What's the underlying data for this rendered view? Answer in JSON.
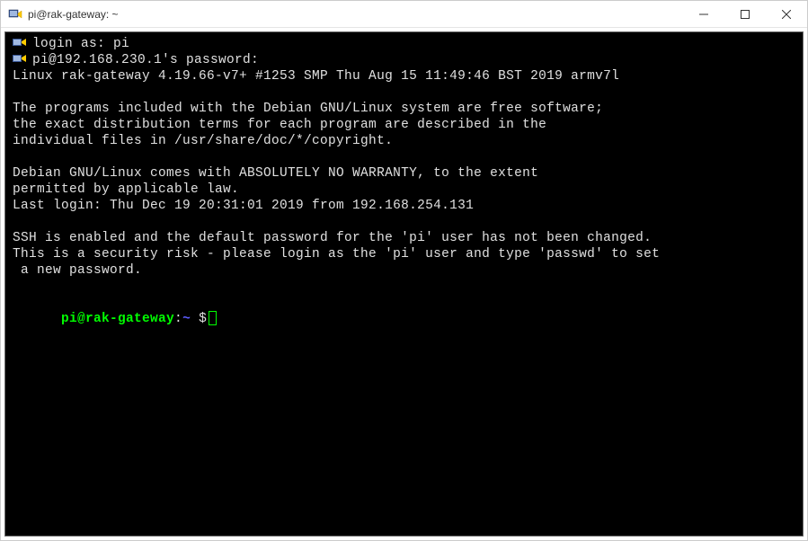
{
  "titlebar": {
    "title": "pi@rak-gateway: ~"
  },
  "terminal": {
    "login_prompt": "login as: pi",
    "password_prompt": "pi@192.168.230.1's password:",
    "kernel_line": "Linux rak-gateway 4.19.66-v7+ #1253 SMP Thu Aug 15 11:49:46 BST 2019 armv7l",
    "motd_line1": "The programs included with the Debian GNU/Linux system are free software;",
    "motd_line2": "the exact distribution terms for each program are described in the",
    "motd_line3": "individual files in /usr/share/doc/*/copyright.",
    "motd_line4": "Debian GNU/Linux comes with ABSOLUTELY NO WARRANTY, to the extent",
    "motd_line5": "permitted by applicable law.",
    "last_login": "Last login: Thu Dec 19 20:31:01 2019 from 192.168.254.131",
    "ssh_warn1": "SSH is enabled and the default password for the 'pi' user has not been changed.",
    "ssh_warn2": "This is a security risk - please login as the 'pi' user and type 'passwd' to set",
    "ssh_warn3": " a new password.",
    "prompt": {
      "user_host": "pi@rak-gateway",
      "colon": ":",
      "path": "~",
      "dollar": " $"
    }
  }
}
